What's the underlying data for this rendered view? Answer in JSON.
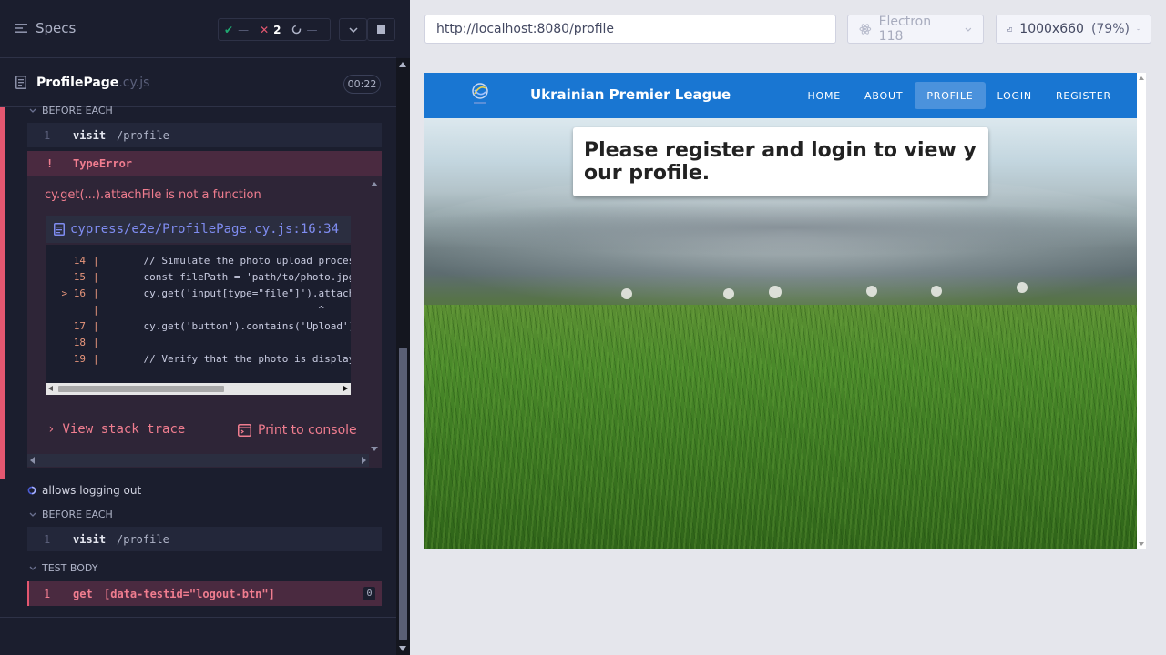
{
  "left": {
    "specs_label": "Specs",
    "stats": {
      "passed": "—",
      "failed": "2",
      "pending": "—"
    },
    "file": {
      "name": "ProfilePage",
      "ext": ".cy.js",
      "duration": "00:22"
    },
    "test1": {
      "hook_label": "BEFORE EACH",
      "visit": {
        "num": "1",
        "name": "visit",
        "arg": "/profile"
      },
      "error": {
        "bang": "!",
        "type": "TypeError",
        "message": "cy.get(...).attachFile is not a function",
        "file_link": "cypress/e2e/ProfilePage.cy.js:16:34",
        "code": [
          {
            "ln": "14",
            "bar": "|",
            "text": "    // Simulate the photo upload process"
          },
          {
            "ln": "15",
            "bar": "|",
            "text": "    const filePath = 'path/to/photo.jpg' //"
          },
          {
            "ln": "> 16",
            "bar": "|",
            "text": "    cy.get('input[type=\"file\"]').attachFile"
          },
          {
            "ln": "",
            "bar": "|",
            "text": "                                 ^"
          },
          {
            "ln": "17",
            "bar": "|",
            "text": "    cy.get('button').contains('Upload').cli"
          },
          {
            "ln": "18",
            "bar": "|",
            "text": ""
          },
          {
            "ln": "19",
            "bar": "|",
            "text": "    // Verify that the photo is displayed a"
          }
        ],
        "stack_label": "View stack trace",
        "print_label": "Print to console"
      }
    },
    "test2": {
      "title": "allows logging out",
      "hook_label": "BEFORE EACH",
      "visit": {
        "num": "1",
        "name": "visit",
        "arg": "/profile"
      },
      "body_label": "TEST BODY",
      "get": {
        "num": "1",
        "name": "get",
        "arg": "[data-testid=\"logout-btn\"]",
        "badge": "0"
      }
    }
  },
  "right": {
    "url": "http://localhost:8080/profile",
    "browser": "Electron 118",
    "viewport_size": "1000x660",
    "viewport_scale": "(79%)",
    "app": {
      "brand": "Ukrainian Premier League",
      "nav": [
        "HOME",
        "ABOUT",
        "PROFILE",
        "LOGIN",
        "REGISTER"
      ],
      "active_nav": "PROFILE",
      "message": "Please register and login to view your profile."
    }
  },
  "colors": {
    "fail": "#e45770",
    "pass": "#1fa971",
    "navbar": "#1976d2"
  }
}
